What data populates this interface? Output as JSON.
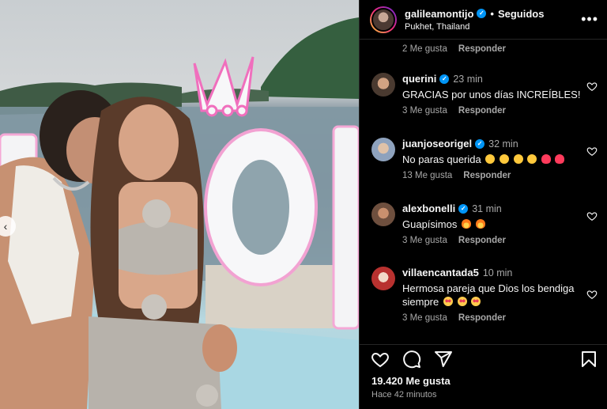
{
  "post": {
    "username": "galileamontijo",
    "follow_status": "Seguidos",
    "location": "Pukhet, Thailand",
    "likes": "19.420 Me gusta",
    "time_ago": "Hace 42 minutos"
  },
  "first_meta": {
    "likes": "2 Me gusta",
    "reply": "Responder"
  },
  "comments": [
    {
      "username": "querini",
      "verified": true,
      "time": "23 min",
      "text": "GRACIAS por unos días INCREÍBLES!",
      "likes": "3 Me gusta",
      "reply": "Responder",
      "avatar_color": "#7a5b48"
    },
    {
      "username": "juanjoseorigel",
      "verified": true,
      "time": "32 min",
      "text": "No paras querida",
      "emojis": [
        "clap",
        "clap",
        "clap",
        "clap",
        "heart",
        "heart"
      ],
      "likes": "13 Me gusta",
      "reply": "Responder",
      "avatar_color": "#a9b6c8"
    },
    {
      "username": "alexbonelli",
      "verified": true,
      "time": "31 min",
      "text": "Guapísimos",
      "emojis": [
        "fire",
        "fire"
      ],
      "likes": "3 Me gusta",
      "reply": "Responder",
      "avatar_color": "#8a6a55"
    },
    {
      "username": "villaencantada5",
      "verified": false,
      "time": "10 min",
      "text": "Hermosa pareja que Dios los bendiga siempre",
      "emojis": [
        "love",
        "love",
        "love"
      ],
      "likes": "3 Me gusta",
      "reply": "Responder",
      "avatar_color": "#b8312f"
    }
  ],
  "icons": {
    "like": "heart-icon",
    "comment": "comment-icon",
    "share": "send-icon",
    "save": "bookmark-icon",
    "more": "more-options-icon",
    "prev": "chevron-left-icon"
  },
  "colors": {
    "background": "#000000",
    "verified": "#0095f6",
    "muted_text": "#a8a8a8",
    "divider": "#262626"
  }
}
